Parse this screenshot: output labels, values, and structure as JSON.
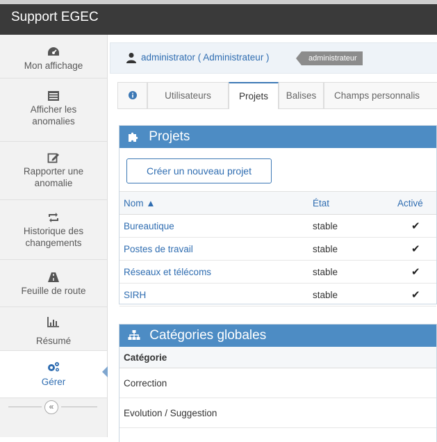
{
  "app": {
    "title": "Support EGEC"
  },
  "sidebar": {
    "items": [
      {
        "label": "Mon affichage",
        "icon": "tachometer-icon"
      },
      {
        "label": "Afficher les anomalies",
        "icon": "list-icon"
      },
      {
        "label": "Rapporter une anomalie",
        "icon": "edit-icon"
      },
      {
        "label": "Historique des changements",
        "icon": "retweet-icon"
      },
      {
        "label": "Feuille de route",
        "icon": "road-icon"
      },
      {
        "label": "Résumé",
        "icon": "bar-chart-icon"
      },
      {
        "label": "Gérer",
        "icon": "gears-icon",
        "active": true
      }
    ],
    "collapse_label": "«"
  },
  "user": {
    "name": "administrator ( Administrateur )",
    "role_badge": "administrateur"
  },
  "tabs": [
    {
      "label": "",
      "icon": "info-icon"
    },
    {
      "label": "Utilisateurs"
    },
    {
      "label": "Projets",
      "active": true
    },
    {
      "label": "Balises"
    },
    {
      "label": "Champs personnalis"
    }
  ],
  "projects_panel": {
    "title": "Projets",
    "create_button": "Créer un nouveau projet",
    "columns": [
      "Nom ▲",
      "État",
      "Activé"
    ],
    "rows": [
      {
        "name": "Bureautique",
        "state": "stable",
        "enabled": "✔"
      },
      {
        "name": "Postes de travail",
        "state": "stable",
        "enabled": "✔"
      },
      {
        "name": "Réseaux et télécoms",
        "state": "stable",
        "enabled": "✔"
      },
      {
        "name": "SIRH",
        "state": "stable",
        "enabled": "✔"
      }
    ]
  },
  "categories_panel": {
    "title": "Catégories globales",
    "column": "Catégorie",
    "rows": [
      "Correction",
      "Evolution / Suggestion"
    ]
  },
  "colors": {
    "accent": "#4d8cc4",
    "link": "#2f6db1",
    "topbar": "#3a3a3a",
    "badge": "#8c8c8c"
  }
}
